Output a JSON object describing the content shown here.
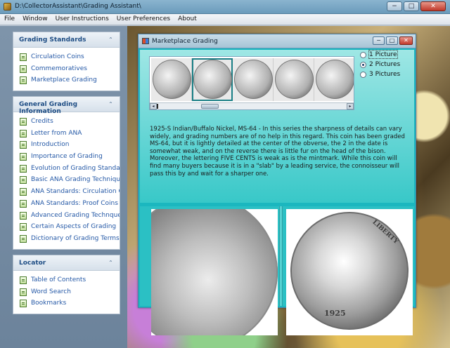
{
  "window": {
    "title": "D:\\CollectorAssistant\\Grading Assistant\\",
    "controls": {
      "minimize": "−",
      "maximize": "□",
      "close": "✕"
    }
  },
  "menubar": [
    "File",
    "Window",
    "User Instructions",
    "User Preferences",
    "About"
  ],
  "sidebar": {
    "groups": [
      {
        "title": "Grading Standards",
        "collapse_glyph": "⌃",
        "items": [
          "Circulation Coins",
          "Commemoratives",
          "Marketplace Grading"
        ]
      },
      {
        "title": "General Grading Information",
        "collapse_glyph": "⌃",
        "items": [
          "Credits",
          "Letter from ANA",
          "Introduction",
          "Importance of Grading",
          "Evolution of Grading Standards",
          "Basic ANA Grading Techniques",
          "ANA Standards: Circulation Coi...",
          "ANA Standards: Proof Coins",
          "Advanced Grading Technques",
          "Certain Aspects of Grading",
          "Dictionary of Grading Terms"
        ]
      },
      {
        "title": "Locator",
        "collapse_glyph": "⌃",
        "items": [
          "Table of Contents",
          "Word Search",
          "Bookmarks"
        ]
      }
    ]
  },
  "child_window": {
    "title": "Marketplace Grading",
    "controls": {
      "minimize": "−",
      "maximize": "□",
      "close": "✕"
    },
    "thumbnails": [
      "buffalo-nickel-thumbnail-1",
      "buffalo-nickel-thumbnail-2",
      "buffalo-nickel-thumbnail-3",
      "buffalo-nickel-thumbnail-4",
      "buffalo-nickel-thumbnail-5"
    ],
    "scroll": {
      "left_arrow": "◂",
      "right_arrow": "▸"
    },
    "picture_options": [
      {
        "label": "1 Picture",
        "checked": false,
        "focused": true
      },
      {
        "label": "2 Pictures",
        "checked": true,
        "focused": false
      },
      {
        "label": "3 Pictures",
        "checked": false,
        "focused": false
      }
    ],
    "description": "1925-S Indian/Buffalo Nickel, MS-64 - In this series the sharpness of details can vary widely, and grading numbers are of no help in this regard. This coin has been graded MS-64, but it is lightly detailed at the center of the obverse, the 2 in the date is somewhat weak, and on the reverse there is little fur on the head of the bison. Moreover, the lettering FIVE CENTS is weak as is the mintmark. While this coin will find many buyers because it is in a \"slab\" by a leading service, the connoisseur will pass this by and wait for a sharper one.",
    "coin_inscription": {
      "liberty": "LIBERTY",
      "date": "1925"
    }
  }
}
